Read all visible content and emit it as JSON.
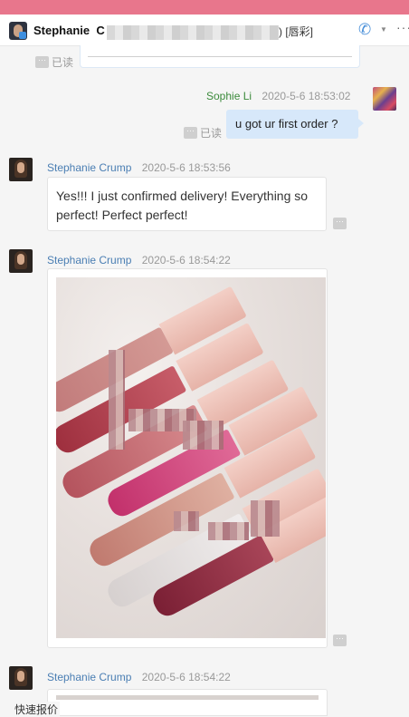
{
  "header": {
    "contact_name": "Stephanie",
    "contact_initial": "C",
    "tag_text": ") [唇彩]"
  },
  "read_status_label": "已读",
  "more_glyph": "···",
  "messages": [
    {
      "sender": "Sophie Li",
      "timestamp": "2020-5-6 18:53:02",
      "text": "u got ur first order ?"
    },
    {
      "sender": "Stephanie Crump",
      "timestamp": "2020-5-6 18:53:56",
      "text": "Yes!!! I just confirmed delivery! Everything so perfect! Perfect perfect!"
    },
    {
      "sender": "Stephanie Crump",
      "timestamp": "2020-5-6 18:54:22",
      "image": "lip-gloss-product-photo"
    },
    {
      "sender": "Stephanie Crump",
      "timestamp": "2020-5-6 18:54:22",
      "image": "product-photo-partial"
    }
  ],
  "bottom_bar": {
    "quick_quote_label": "快速报价"
  },
  "icons": {
    "phone": "phone-call-icon",
    "more": "more-horizontal-icon",
    "dropdown": "chevron-down-icon"
  },
  "colors": {
    "topbar": "#e8768c",
    "outgoing_bubble": "#d7e8fa",
    "sender_name": "#4a7eb3",
    "self_name": "#3b8a3b"
  }
}
